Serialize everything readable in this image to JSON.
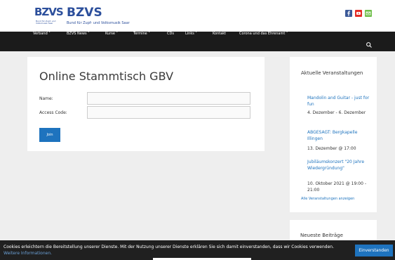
{
  "header": {
    "logo_mark": "BZVS",
    "logo_sub_lines": [
      "Bund für Zupf- und",
      "Volksmusik Saar"
    ],
    "site_title": "BZVS",
    "site_description": "Bund für Zupf- und Volksmusik Saar",
    "social_icons": [
      {
        "name": "facebook-icon",
        "color": "#3b5998"
      },
      {
        "name": "youtube-icon",
        "color": "#e52d27"
      },
      {
        "name": "email-icon",
        "color": "#6fbf4a"
      }
    ]
  },
  "nav": {
    "items": [
      "Verband ˅",
      "BZVS News ˅",
      "Kurse ˅",
      "Termine ˅",
      "CDs",
      "Links ˅",
      "Kontakt",
      "Corona und das Ehrenamt ˅"
    ],
    "search_icon": "search-icon"
  },
  "main": {
    "title": "Online Stammtisch GBV",
    "fields": [
      {
        "label": "Name:",
        "value": ""
      },
      {
        "label": "Access Code:",
        "value": ""
      }
    ],
    "join_label": "Join"
  },
  "sidebar": {
    "title": "Aktuelle Veranstaltungen",
    "events": [
      {
        "title": "Mandolin and Guitar - just for fun",
        "date": "4. Dezember - 6. Dezember"
      },
      {
        "title": "ABGESAGT: Bergkapelle Illingen",
        "date": "13. Dezember @ 17:00"
      },
      {
        "title": "Jubiläumskonzert \"20 Jahre Wiedergründung\"",
        "date": "10. Oktober 2021 @ 19:00 - 21:00"
      }
    ],
    "all_events_label": "Alle Veranstaltungen anzeigen"
  },
  "sidebar2": {
    "title": "Neueste Beiträge"
  },
  "cookie": {
    "text": "Cookies erleichtern die Bereitstellung unserer Dienste. Mit der Nutzung unserer Dienste erklären Sie sich damit einverstanden, dass wir Cookies verwenden.",
    "link_label": "Weitere Informationen.",
    "button_label": "Einverstanden"
  },
  "colors": {
    "brand": "#2b4e9b",
    "link": "#1e73be",
    "nav_bg": "#1b1b1b"
  }
}
